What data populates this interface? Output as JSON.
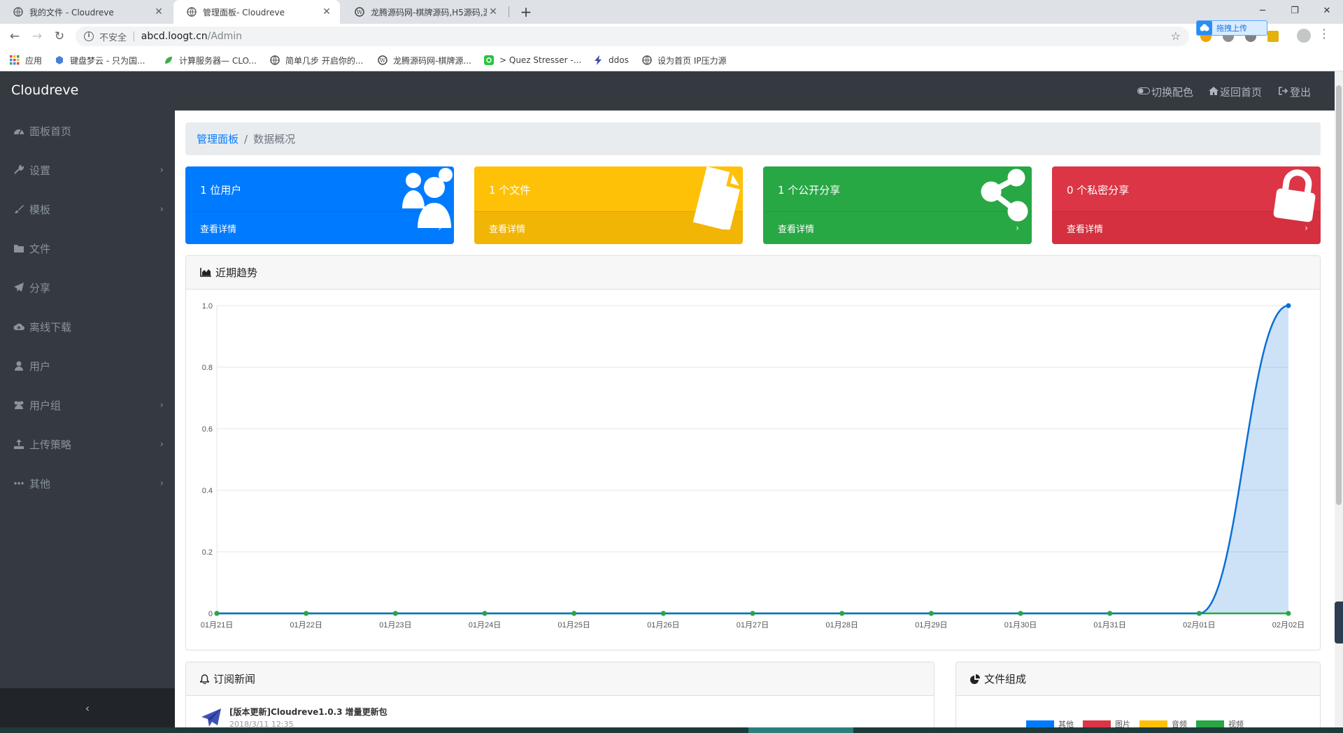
{
  "browser": {
    "tabs": [
      {
        "title": "我的文件 - Cloudreve",
        "active": false
      },
      {
        "title": "管理面板- Cloudreve",
        "active": true
      },
      {
        "title": "龙腾源码网-棋牌源码,H5源码,游",
        "active": false
      }
    ],
    "address": {
      "security": "不安全",
      "host": "abcd.loogt.cn",
      "path": "/Admin"
    },
    "extension_label": "拖拽上传",
    "bookmarks": [
      {
        "label": "应用",
        "icon": "apps-grid-icon"
      },
      {
        "label": "键盘梦云 - 只为国...",
        "icon": "cloud-icon"
      },
      {
        "label": "计算服务器— CLO...",
        "icon": "leaf-icon"
      },
      {
        "label": "简单几步 开启你的...",
        "icon": "globe-icon"
      },
      {
        "label": "龙腾源码网-棋牌源...",
        "icon": "wordpress-icon"
      },
      {
        "label": "> Quez Stresser -...",
        "icon": "q-icon"
      },
      {
        "label": "ddos",
        "icon": "bolt-icon"
      },
      {
        "label": "设为首页 IP压力源",
        "icon": "globe-icon"
      }
    ]
  },
  "header": {
    "brand": "Cloudreve",
    "links": {
      "toggle_theme": "切换配色",
      "home": "返回首页",
      "logout": "登出"
    }
  },
  "sidebar": {
    "items": [
      {
        "label": "面板首页",
        "icon": "dashboard-icon",
        "has_children": false
      },
      {
        "label": "设置",
        "icon": "wrench-icon",
        "has_children": true
      },
      {
        "label": "模板",
        "icon": "paint-brush-icon",
        "has_children": true
      },
      {
        "label": "文件",
        "icon": "folder-icon",
        "has_children": false
      },
      {
        "label": "分享",
        "icon": "paper-plane-icon",
        "has_children": false
      },
      {
        "label": "离线下载",
        "icon": "cloud-download-icon",
        "has_children": false
      },
      {
        "label": "用户",
        "icon": "user-icon",
        "has_children": false
      },
      {
        "label": "用户组",
        "icon": "users-icon",
        "has_children": true
      },
      {
        "label": "上传策略",
        "icon": "upload-icon",
        "has_children": true
      },
      {
        "label": "其他",
        "icon": "ellipsis-icon",
        "has_children": true
      }
    ],
    "collapse": "‹"
  },
  "breadcrumb": {
    "parent": "管理面板",
    "current": "数据概况"
  },
  "stats": [
    {
      "text": "1 位用户",
      "footer": "查看详情",
      "color": "#007bff",
      "icon": "users-icon"
    },
    {
      "text": "1 个文件",
      "footer": "查看详情",
      "color": "#ffc107",
      "icon": "file-icon"
    },
    {
      "text": "1 个公开分享",
      "footer": "查看详情",
      "color": "#28a745",
      "icon": "share-icon"
    },
    {
      "text": "0 个私密分享",
      "footer": "查看详情",
      "color": "#dc3545",
      "icon": "lock-icon"
    }
  ],
  "trend": {
    "title": "近期趋势"
  },
  "news": {
    "title": "订阅新闻",
    "items": [
      {
        "title": "[版本更新]Cloudreve1.0.3 增量更新包",
        "date": "2018/3/11 12:35"
      }
    ]
  },
  "composition": {
    "title": "文件组成",
    "legend": [
      {
        "label": "其他",
        "color": "#007bff"
      },
      {
        "label": "图片",
        "color": "#dc3545"
      },
      {
        "label": "音频",
        "color": "#ffc107"
      },
      {
        "label": "视频",
        "color": "#28a745"
      }
    ]
  },
  "chart_data": {
    "type": "area",
    "x": [
      "01月21日",
      "01月22日",
      "01月23日",
      "01月24日",
      "01月25日",
      "01月26日",
      "01月27日",
      "01月28日",
      "01月29日",
      "01月30日",
      "01月31日",
      "02月01日",
      "02月02日"
    ],
    "series": [
      {
        "color": "#0a6fd6",
        "values": [
          0,
          0,
          0,
          0,
          0,
          0,
          0,
          0,
          0,
          0,
          0,
          0,
          1
        ]
      },
      {
        "color": "#28a745",
        "values": [
          0,
          0,
          0,
          0,
          0,
          0,
          0,
          0,
          0,
          0,
          0,
          0,
          0
        ]
      }
    ],
    "yticks": [
      "0",
      "0.2",
      "0.4",
      "0.6",
      "0.8",
      "1.0"
    ],
    "ylim": [
      0,
      1
    ],
    "grid": true
  }
}
